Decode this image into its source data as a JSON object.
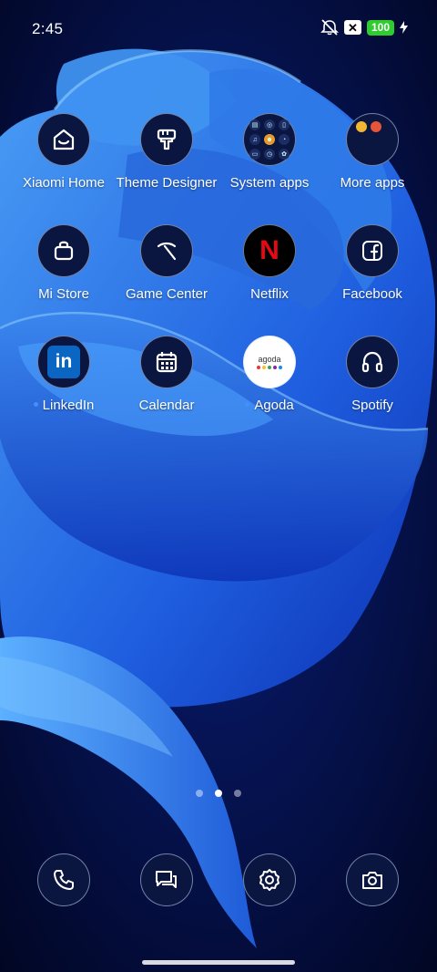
{
  "status_bar": {
    "time": "2:45",
    "battery": "100",
    "icons": [
      "bell-muted-icon",
      "close-box-icon",
      "battery-icon",
      "charging-bolt-icon"
    ]
  },
  "apps": [
    {
      "label": "Xiaomi Home",
      "icon": "xiaomi-home-icon",
      "new": false
    },
    {
      "label": "Theme Designer",
      "icon": "theme-designer-icon",
      "new": false
    },
    {
      "label": "System apps",
      "icon": "folder-icon",
      "new": false
    },
    {
      "label": "More apps",
      "icon": "folder-icon",
      "new": false
    },
    {
      "label": "Mi Store",
      "icon": "shopping-bag-icon",
      "new": false
    },
    {
      "label": "Game Center",
      "icon": "game-center-icon",
      "new": false
    },
    {
      "label": "Netflix",
      "icon": "netflix-icon",
      "new": false
    },
    {
      "label": "Facebook",
      "icon": "facebook-icon",
      "new": false
    },
    {
      "label": "LinkedIn",
      "icon": "linkedin-icon",
      "new": true
    },
    {
      "label": "Calendar",
      "icon": "calendar-icon",
      "new": false
    },
    {
      "label": "Agoda",
      "icon": "agoda-icon",
      "new": true
    },
    {
      "label": "Spotify",
      "icon": "headphones-icon",
      "new": false
    }
  ],
  "icon_text": {
    "netflix": "N",
    "linkedin": "in",
    "agoda": "agoda"
  },
  "pager": {
    "pages": 3,
    "active": 2
  },
  "dock": [
    "phone-icon",
    "messages-icon",
    "settings-icon",
    "camera-icon"
  ],
  "colors": {
    "icon_bg": "#0a1640",
    "battery_green": "#2ecc2e",
    "netflix_red": "#e50914",
    "linkedin_blue": "#0a66c2",
    "new_dot": "#4a8cff"
  }
}
